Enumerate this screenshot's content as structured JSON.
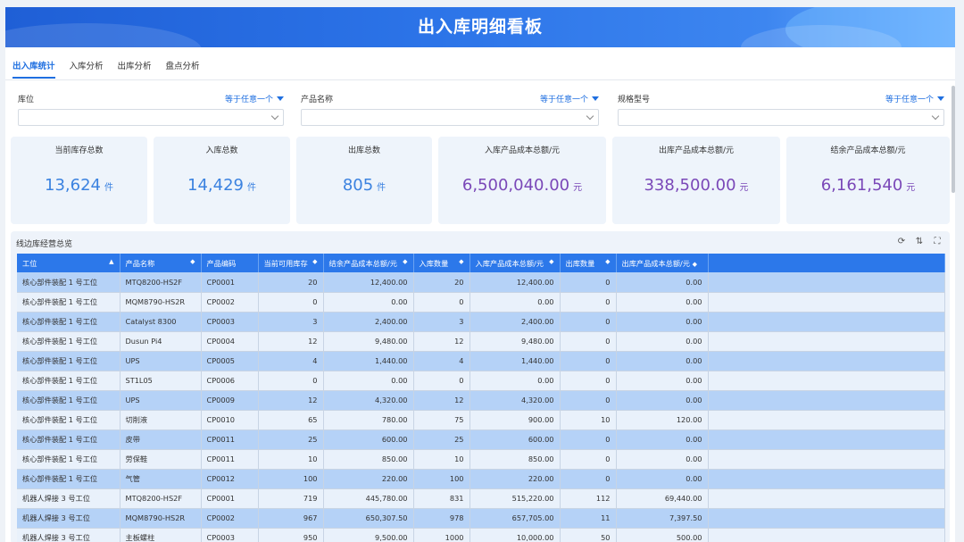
{
  "header": {
    "title": "出入库明细看板"
  },
  "tabs": [
    "出入库统计",
    "入库分析",
    "出库分析",
    "盘点分析"
  ],
  "filters": [
    {
      "label": "库位",
      "operator": "等于任意一个"
    },
    {
      "label": "产品名称",
      "operator": "等于任意一个"
    },
    {
      "label": "规格型号",
      "operator": "等于任意一个"
    }
  ],
  "cards": [
    {
      "title": "当前库存总数",
      "value": "13,624",
      "unit": "件"
    },
    {
      "title": "入库总数",
      "value": "14,429",
      "unit": "件"
    },
    {
      "title": "出库总数",
      "value": "805",
      "unit": "件"
    },
    {
      "title": "入库产品成本总额/元",
      "value": "6,500,040.00",
      "unit": "元"
    },
    {
      "title": "出库产品成本总额/元",
      "value": "338,500.00",
      "unit": "元"
    },
    {
      "title": "结余产品成本总额/元",
      "value": "6,161,540",
      "unit": "元"
    }
  ],
  "colors": {
    "accent": "#2c78ea",
    "blue_value": "#3b82e0",
    "purple_value": "#7a48b8"
  },
  "panel": {
    "title": "线边库经营总览",
    "columns": [
      "工位",
      "产品名称",
      "产品编码",
      "当前可用库存",
      "结余产品成本总额/元",
      "入库数量",
      "入库产品成本总额/元",
      "出库数量",
      "出库产品成本总额/元"
    ],
    "rows": [
      [
        "核心部件装配 1 号工位",
        "MTQ8200-HS2F",
        "CP0001",
        "20",
        "12,400.00",
        "20",
        "12,400.00",
        "0",
        "0.00"
      ],
      [
        "核心部件装配 1 号工位",
        "MQM8790-HS2R",
        "CP0002",
        "0",
        "0.00",
        "0",
        "0.00",
        "0",
        "0.00"
      ],
      [
        "核心部件装配 1 号工位",
        "Catalyst 8300",
        "CP0003",
        "3",
        "2,400.00",
        "3",
        "2,400.00",
        "0",
        "0.00"
      ],
      [
        "核心部件装配 1 号工位",
        "Dusun Pi4",
        "CP0004",
        "12",
        "9,480.00",
        "12",
        "9,480.00",
        "0",
        "0.00"
      ],
      [
        "核心部件装配 1 号工位",
        "UPS",
        "CP0005",
        "4",
        "1,440.00",
        "4",
        "1,440.00",
        "0",
        "0.00"
      ],
      [
        "核心部件装配 1 号工位",
        "ST1L05",
        "CP0006",
        "0",
        "0.00",
        "0",
        "0.00",
        "0",
        "0.00"
      ],
      [
        "核心部件装配 1 号工位",
        "UPS",
        "CP0009",
        "12",
        "4,320.00",
        "12",
        "4,320.00",
        "0",
        "0.00"
      ],
      [
        "核心部件装配 1 号工位",
        "切削液",
        "CP0010",
        "65",
        "780.00",
        "75",
        "900.00",
        "10",
        "120.00"
      ],
      [
        "核心部件装配 1 号工位",
        "皮带",
        "CP0011",
        "25",
        "600.00",
        "25",
        "600.00",
        "0",
        "0.00"
      ],
      [
        "核心部件装配 1 号工位",
        "劳保鞋",
        "CP0011",
        "10",
        "850.00",
        "10",
        "850.00",
        "0",
        "0.00"
      ],
      [
        "核心部件装配 1 号工位",
        "气管",
        "CP0012",
        "100",
        "220.00",
        "100",
        "220.00",
        "0",
        "0.00"
      ],
      [
        "机器人焊接 3 号工位",
        "MTQ8200-HS2F",
        "CP0001",
        "719",
        "445,780.00",
        "831",
        "515,220.00",
        "112",
        "69,440.00"
      ],
      [
        "机器人焊接 3 号工位",
        "MQM8790-HS2R",
        "CP0002",
        "967",
        "650,307.50",
        "978",
        "657,705.00",
        "11",
        "7,397.50"
      ],
      [
        "机器人焊接 3 号工位",
        "主板螺柱",
        "CP0003",
        "950",
        "9,500.00",
        "1000",
        "10,000.00",
        "50",
        "500.00"
      ]
    ]
  }
}
